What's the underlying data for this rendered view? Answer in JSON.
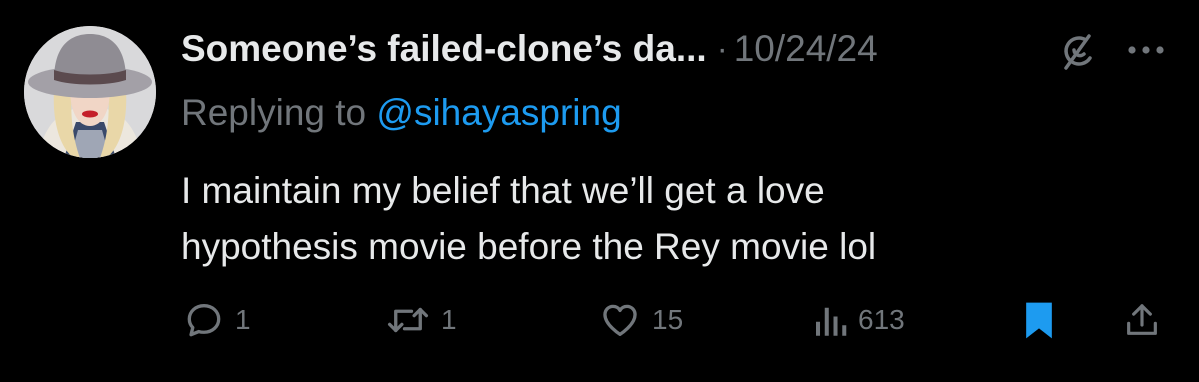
{
  "tweet": {
    "display_name": "Someone’s failed-clone’s da...",
    "separator": "·",
    "date": "10/24/24",
    "replying_prefix": "Replying to ",
    "replying_handle": "@sihayaspring",
    "text_line1": "I maintain my belief that we’ll get a love",
    "text_line2": "hypothesis movie before the Rey movie lol"
  },
  "actions": {
    "replies": "1",
    "reposts": "1",
    "likes": "15",
    "views": "613"
  },
  "icons": [
    "grok-icon",
    "more-icon",
    "reply-icon",
    "repost-icon",
    "like-icon",
    "views-icon",
    "bookmark-icon",
    "share-icon"
  ],
  "colors": {
    "background": "#000000",
    "text": "#e7e9ea",
    "muted": "#71767b",
    "accent": "#1d9bf0"
  }
}
